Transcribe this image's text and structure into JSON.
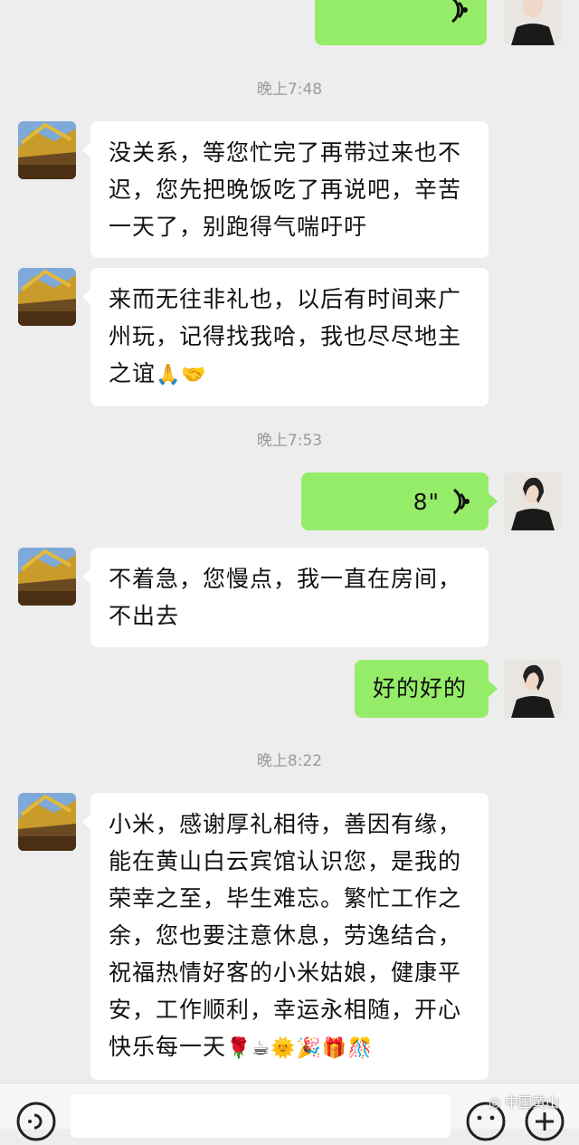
{
  "timestamps": [
    "晚上7:48",
    "晚上7:53",
    "晚上8:22"
  ],
  "messages": {
    "m1": "没关系，等您忙完了再带过来也不迟，您先把晚饭吃了再说吧，辛苦一天了，别跑得气喘吁吁",
    "m2": "来而无往非礼也，以后有时间来广州玩，记得找我哈，我也尽尽地主之谊",
    "m2_emoji": "🙏🤝",
    "voice_duration": "8\"",
    "m3": "不着急，您慢点，我一直在房间，不出去",
    "m4": "好的好的",
    "m5": "小米，感谢厚礼相待，善因有缘，能在黄山白云宾馆认识您，是我的荣幸之至，毕生难忘。繁忙工作之余，您也要注意休息，劳逸结合，祝福热情好客的小米姑娘，健康平安，工作顺利，幸运永相随，开心快乐每一天",
    "m5_emoji": "🌹☕🌞🎉🎁🎊"
  },
  "watermark": "中国黄山",
  "colors": {
    "background": "#ededed",
    "my_bubble": "#95ec69",
    "their_bubble": "#ffffff",
    "timestamp": "#9a9a9a"
  }
}
